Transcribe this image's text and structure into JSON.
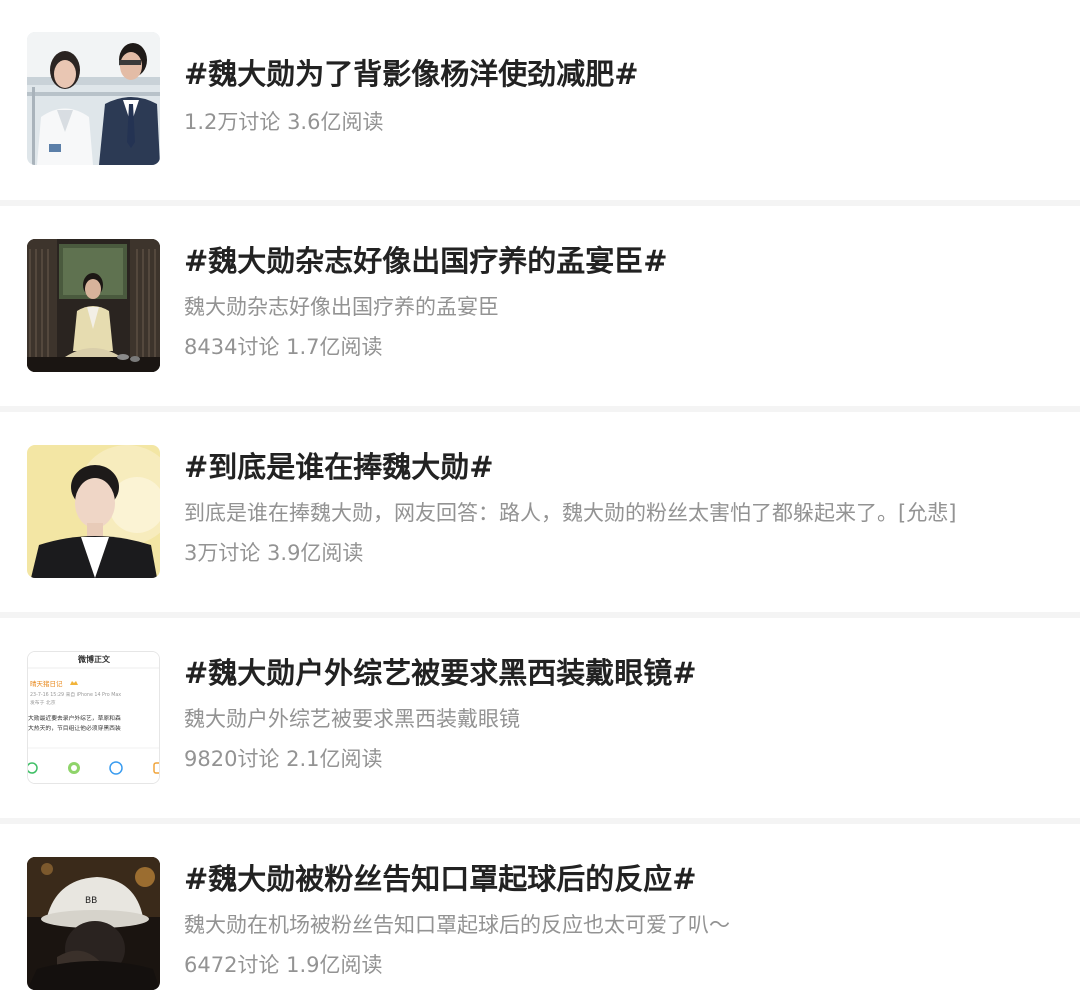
{
  "topics": [
    {
      "title": "#魏大勋为了背影像杨洋使劲减肥#",
      "description": "",
      "stats": "1.2万讨论 3.6亿阅读"
    },
    {
      "title": "#魏大勋杂志好像出国疗养的孟宴臣#",
      "description": "魏大勋杂志好像出国疗养的孟宴臣",
      "stats": "8434讨论 1.7亿阅读"
    },
    {
      "title": "#到底是谁在捧魏大勋#",
      "description": "到底是谁在捧魏大勋，网友回答：路人，魏大勋的粉丝太害怕了都躲起来了。[允悲]",
      "stats": "3万讨论 3.9亿阅读"
    },
    {
      "title": "#魏大勋户外综艺被要求黑西装戴眼镜#",
      "description": "魏大勋户外综艺被要求黑西装戴眼镜",
      "stats": "9820讨论 2.1亿阅读"
    },
    {
      "title": "#魏大勋被粉丝告知口罩起球后的反应#",
      "description": "魏大勋在机场被粉丝告知口罩起球后的反应也太可爱了叭～",
      "stats": "6472讨论 1.9亿阅读"
    }
  ],
  "thumb4": {
    "header": "微博正文",
    "user": "晴天猪日记",
    "meta": "23-7-16 15:29 来自 iPhone 14 Pro Max",
    "meta2": "发布于 北京",
    "line1": "大勋最近要去录户外综艺，草原和森",
    "line2": "大热天的，节目组让他必须穿黑西装"
  },
  "colors": {
    "title": "#222222",
    "secondary": "#939393",
    "separator": "#f4f4f4",
    "weibo_orange": "#e8891c"
  }
}
